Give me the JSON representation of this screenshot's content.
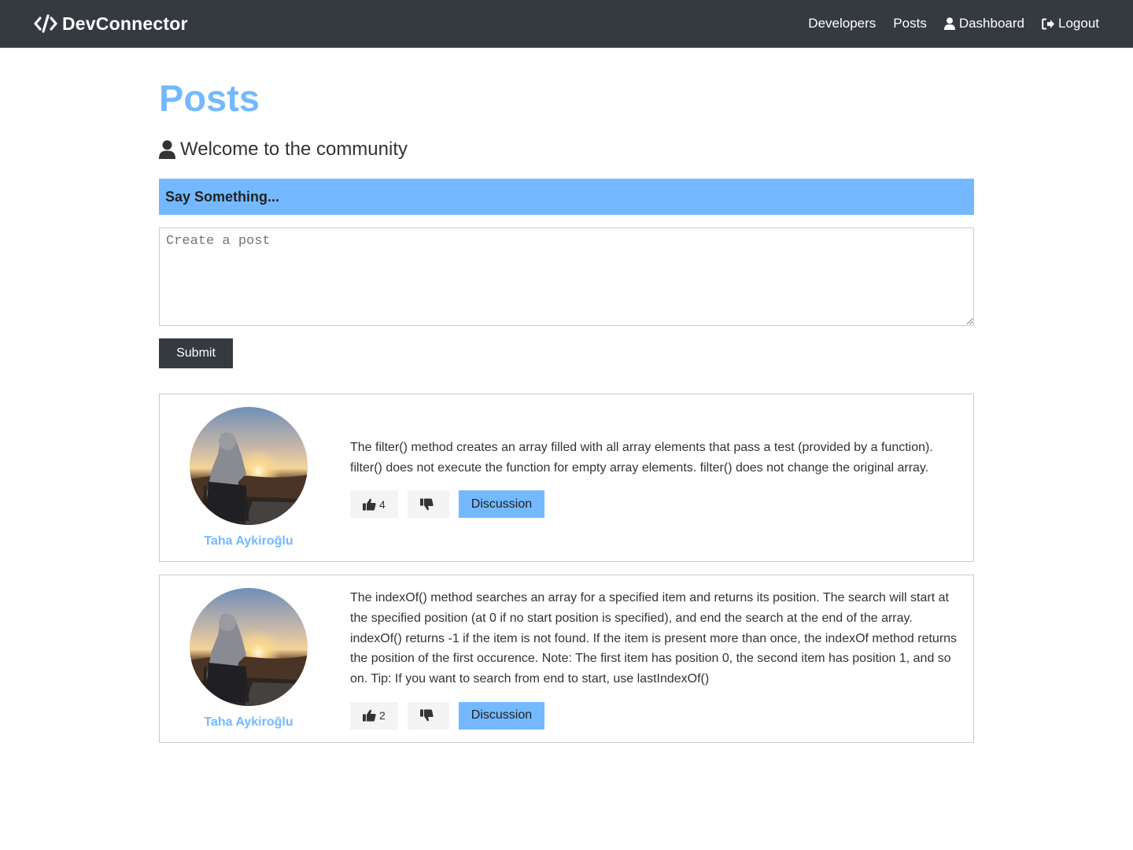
{
  "navbar": {
    "brand": "DevConnector",
    "links": {
      "developers": "Developers",
      "posts": "Posts",
      "dashboard": "Dashboard",
      "logout": "Logout"
    }
  },
  "page": {
    "title": "Posts",
    "lead": "Welcome to the community"
  },
  "post_form": {
    "header": "Say Something...",
    "placeholder": "Create a post",
    "submit_label": "Submit"
  },
  "posts": [
    {
      "author": "Taha Aykiroğlu",
      "text": "The filter() method creates an array filled with all array elements that pass a test (provided by a function). filter() does not execute the function for empty array elements. filter() does not change the original array.",
      "likes": "4",
      "discussion_label": "Discussion"
    },
    {
      "author": "Taha Aykiroğlu",
      "text": "The indexOf() method searches an array for a specified item and returns its position. The search will start at the specified position (at 0 if no start position is specified), and end the search at the end of the array. indexOf() returns -1 if the item is not found. If the item is present more than once, the indexOf method returns the position of the first occurence. Note: The first item has position 0, the second item has position 1, and so on. Tip: If you want to search from end to start, use lastIndexOf()",
      "likes": "2",
      "discussion_label": "Discussion"
    }
  ],
  "colors": {
    "navbar_bg": "#343a40",
    "primary": "#74b9ff",
    "light": "#f4f4f4"
  }
}
